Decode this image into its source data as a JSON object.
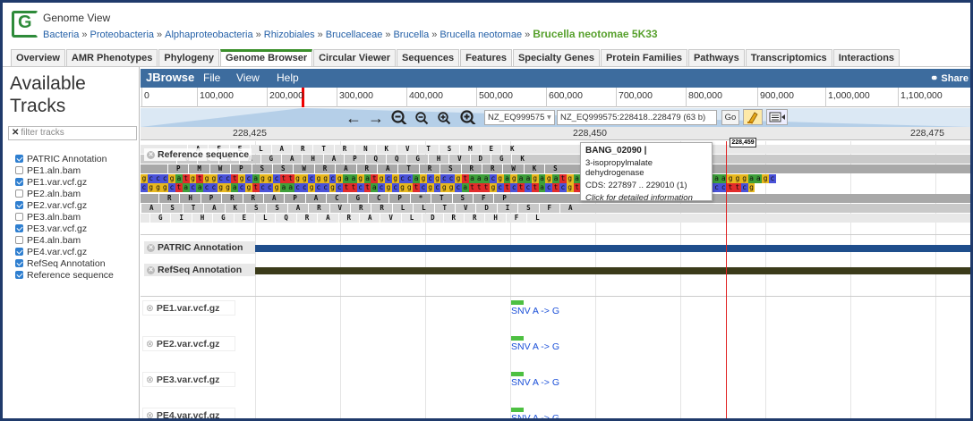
{
  "header": {
    "logo_letter": "G",
    "title": "Genome View",
    "breadcrumbs": [
      "Bacteria",
      "Proteobacteria",
      "Alphaproteobacteria",
      "Rhizobiales",
      "Brucellaceae",
      "Brucella",
      "Brucella neotomae"
    ],
    "separator": "»",
    "current": "Brucella neotomae 5K33"
  },
  "tabs": [
    {
      "label": "Overview",
      "active": false
    },
    {
      "label": "AMR Phenotypes",
      "active": false
    },
    {
      "label": "Phylogeny",
      "active": false
    },
    {
      "label": "Genome Browser",
      "active": true
    },
    {
      "label": "Circular Viewer",
      "active": false
    },
    {
      "label": "Sequences",
      "active": false
    },
    {
      "label": "Features",
      "active": false
    },
    {
      "label": "Specialty Genes",
      "active": false
    },
    {
      "label": "Protein Families",
      "active": false
    },
    {
      "label": "Pathways",
      "active": false
    },
    {
      "label": "Transcriptomics",
      "active": false
    },
    {
      "label": "Interactions",
      "active": false
    }
  ],
  "left": {
    "title": "Available Tracks",
    "filter_icon": "x-icon",
    "filter_placeholder": "filter tracks",
    "tracks": [
      {
        "label": "PATRIC Annotation",
        "checked": true
      },
      {
        "label": "PE1.aln.bam",
        "checked": false
      },
      {
        "label": "PE1.var.vcf.gz",
        "checked": true
      },
      {
        "label": "PE2.aln.bam",
        "checked": false
      },
      {
        "label": "PE2.var.vcf.gz",
        "checked": true
      },
      {
        "label": "PE3.aln.bam",
        "checked": false
      },
      {
        "label": "PE3.var.vcf.gz",
        "checked": true
      },
      {
        "label": "PE4.aln.bam",
        "checked": false
      },
      {
        "label": "PE4.var.vcf.gz",
        "checked": true
      },
      {
        "label": "RefSeq Annotation",
        "checked": true
      },
      {
        "label": "Reference sequence",
        "checked": true
      }
    ]
  },
  "menubar": {
    "brand": "JBrowse",
    "menus": [
      "File",
      "View",
      "Help"
    ],
    "share": "Share",
    "share_icon": "link-icon"
  },
  "overview_ruler": {
    "labels": [
      "0",
      "100,000",
      "200,000",
      "300,000",
      "400,000",
      "500,000",
      "600,000",
      "700,000",
      "800,000",
      "900,000",
      "1,000,000",
      "1,100,000"
    ]
  },
  "nav": {
    "pan_left_icon": "arrow-left-icon",
    "pan_right_icon": "arrow-right-icon",
    "zoom_out_big_icon": "zoom-out-big-icon",
    "zoom_out_icon": "zoom-out-icon",
    "zoom_in_icon": "zoom-in-icon",
    "zoom_in_big_icon": "zoom-in-big-icon",
    "ref_select": "NZ_EQ999575",
    "location": "NZ_EQ999575:228418..228479 (63 b)",
    "go_label": "Go",
    "highlight_icon": "highlighter-icon",
    "track_icon": "track-list-icon"
  },
  "detail_ruler": {
    "labels": [
      "228,425",
      "228,450",
      "228,475"
    ],
    "current_pos": "228,459"
  },
  "sequence": {
    "label": "Reference sequence",
    "fwd_frame1": "A F E L A R T R N K V T S M E K",
    "fwd_frame2": "G L R A G A H A P Q Q G H V D G K",
    "fwd_frame3": "P M W P S S W R A R A T R S R R W K S",
    "fwd_nt": "gcccgatgtggcctgcaggcttggcggcgaagatgcgccagcgccgtaaacgagaagagatgagcatggcacgcgctagcgaaagggaagc",
    "rev_nt": "cgggctacaccggacgtccgaaccgccgcttctacgcggtcgcggcatttgctctctactcgtaccgtgcgcgatcgctttcccttcg",
    "rev_frame1": "R H P R R A P A C G C P * T S F P",
    "rev_frame2": "A S T A K S S A R V R R L L T V D I S F A",
    "rev_frame3": "G I H G E L Q R A R A V L D R R H F L"
  },
  "feature_tracks": [
    {
      "label": "PATRIC Annotation",
      "color": "#1f4e8c"
    },
    {
      "label": "RefSeq Annotation",
      "color": "#3b3b1a"
    }
  ],
  "vcf_tracks": [
    {
      "label": "PE1.var.vcf.gz",
      "variant": "SNV A -> G"
    },
    {
      "label": "PE2.var.vcf.gz",
      "variant": "SNV A -> G"
    },
    {
      "label": "PE3.var.vcf.gz",
      "variant": "SNV A -> G"
    },
    {
      "label": "PE4.var.vcf.gz",
      "variant": "SNV A -> G"
    }
  ],
  "tooltip": {
    "id": "BANG_02090 |",
    "product": "3-isopropylmalate dehydrogenase",
    "cds": "CDS: 227897 .. 229010 (1)",
    "hint": "Click for detailed information"
  },
  "colors": {
    "a": "#3e9f3a",
    "c": "#4a52d8",
    "g": "#e8b81e",
    "t": "#e22b2b",
    "menubar": "#3d6c9e",
    "marker": "#e02020"
  }
}
